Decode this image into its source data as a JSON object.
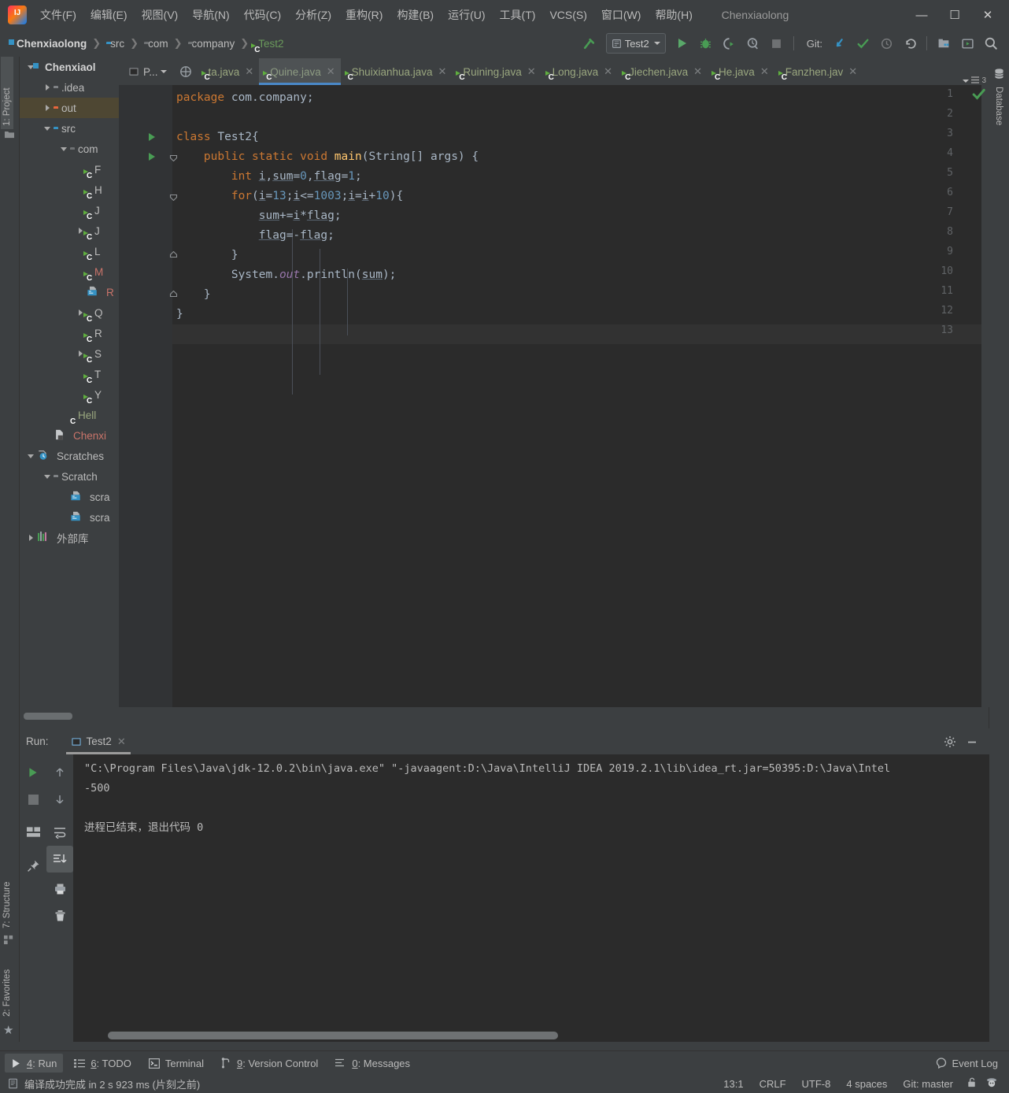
{
  "window": {
    "title": "Chenxiaolong",
    "minimize": "—",
    "maximize": "☐",
    "close": "✕"
  },
  "menu": {
    "items": [
      {
        "label": "文件(F)",
        "name": "menu-file"
      },
      {
        "label": "编辑(E)",
        "name": "menu-edit"
      },
      {
        "label": "视图(V)",
        "name": "menu-view"
      },
      {
        "label": "导航(N)",
        "name": "menu-navigate"
      },
      {
        "label": "代码(C)",
        "name": "menu-code"
      },
      {
        "label": "分析(Z)",
        "name": "menu-analyze"
      },
      {
        "label": "重构(R)",
        "name": "menu-refactor"
      },
      {
        "label": "构建(B)",
        "name": "menu-build"
      },
      {
        "label": "运行(U)",
        "name": "menu-run"
      },
      {
        "label": "工具(T)",
        "name": "menu-tools"
      },
      {
        "label": "VCS(S)",
        "name": "menu-vcs"
      },
      {
        "label": "窗口(W)",
        "name": "menu-window"
      },
      {
        "label": "帮助(H)",
        "name": "menu-help"
      }
    ]
  },
  "navbar": {
    "breadcrumbs": [
      {
        "label": "Chenxiaolong",
        "icon": "module-icon",
        "style": "bold"
      },
      {
        "label": "src",
        "icon": "folder-blue-icon",
        "style": "normal"
      },
      {
        "label": "com",
        "icon": "folder-dark-icon",
        "style": "normal"
      },
      {
        "label": "company",
        "icon": "folder-dark-icon",
        "style": "normal"
      },
      {
        "label": "Test2",
        "icon": "java-class-icon",
        "style": "green"
      }
    ],
    "separator": "❯",
    "run_config": "Test2",
    "git_label": "Git:",
    "toolbar_icons": [
      "build-hammer-icon",
      "run-icon",
      "debug-icon",
      "run-coverage-icon",
      "profiler-icon",
      "stop-icon",
      "vcs-update-icon",
      "vcs-commit-icon",
      "vcs-history-icon",
      "vcs-rollback-icon",
      "project-structure-icon",
      "select-in-icon",
      "search-everywhere-icon"
    ]
  },
  "left_strip": {
    "top": [
      {
        "label": "1: Project",
        "name": "tool-button-project",
        "selected": true
      }
    ],
    "bottom": [
      {
        "label": "7: Structure",
        "name": "tool-button-structure",
        "selected": false
      },
      {
        "label": "2: Favorites",
        "name": "tool-button-favorites",
        "selected": false
      }
    ]
  },
  "right_strip": {
    "items": [
      {
        "label": "Database",
        "name": "tool-button-database"
      }
    ]
  },
  "project_tree": {
    "header": "Project",
    "nodes": [
      {
        "label": "Chenxiaol",
        "indent": 0,
        "arrow": "down",
        "icon": "module-icon",
        "style": "bold",
        "selected": false
      },
      {
        "label": ".idea",
        "indent": 1,
        "arrow": "right",
        "icon": "folder-gray-icon",
        "style": "normal",
        "selected": false
      },
      {
        "label": "out",
        "indent": 1,
        "arrow": "right",
        "icon": "folder-orange-icon",
        "style": "normal",
        "selected": true
      },
      {
        "label": "src",
        "indent": 1,
        "arrow": "down",
        "icon": "folder-blue-icon",
        "style": "normal",
        "selected": false
      },
      {
        "label": "com",
        "indent": 2,
        "arrow": "down",
        "icon": "folder-dark-icon",
        "style": "normal",
        "selected": false
      },
      {
        "label": "F",
        "indent": 3,
        "arrow": "none",
        "icon": "java-class-icon",
        "style": "normal",
        "selected": false
      },
      {
        "label": "H",
        "indent": 3,
        "arrow": "none",
        "icon": "java-class-icon",
        "style": "normal",
        "selected": false
      },
      {
        "label": "J",
        "indent": 3,
        "arrow": "none",
        "icon": "java-class-icon",
        "style": "normal",
        "selected": false
      },
      {
        "label": "J",
        "indent": 3,
        "arrow": "right",
        "icon": "java-class-icon",
        "style": "normal",
        "selected": false
      },
      {
        "label": "L",
        "indent": 3,
        "arrow": "none",
        "icon": "java-class-icon",
        "style": "normal",
        "selected": false
      },
      {
        "label": "M",
        "indent": 3,
        "arrow": "none",
        "icon": "java-class-icon",
        "style": "red",
        "selected": false
      },
      {
        "label": "R",
        "indent": 3,
        "arrow": "none",
        "icon": "scratch-file-icon",
        "style": "red",
        "selected": false
      },
      {
        "label": "Q",
        "indent": 3,
        "arrow": "right",
        "icon": "java-class-icon",
        "style": "normal",
        "selected": false
      },
      {
        "label": "R",
        "indent": 3,
        "arrow": "none",
        "icon": "java-class-icon",
        "style": "normal",
        "selected": false
      },
      {
        "label": "S",
        "indent": 3,
        "arrow": "right",
        "icon": "java-class-icon",
        "style": "normal",
        "selected": false
      },
      {
        "label": "T",
        "indent": 3,
        "arrow": "none",
        "icon": "java-class-icon",
        "style": "normal",
        "selected": false
      },
      {
        "label": "Y",
        "indent": 3,
        "arrow": "none",
        "icon": "java-class-icon",
        "style": "normal",
        "selected": false
      },
      {
        "label": "Hell",
        "indent": 2,
        "arrow": "none",
        "icon": "java-class-plain-icon",
        "style": "grn",
        "selected": false
      },
      {
        "label": "Chenxi",
        "indent": 1,
        "arrow": "none",
        "icon": "iml-file-icon",
        "style": "red",
        "selected": false
      },
      {
        "label": "Scratches",
        "indent": 0,
        "arrow": "down",
        "icon": "scratches-icon",
        "style": "normal",
        "selected": false
      },
      {
        "label": "Scratch",
        "indent": 1,
        "arrow": "down",
        "icon": "folder-gray-icon",
        "style": "normal",
        "selected": false
      },
      {
        "label": "scra",
        "indent": 2,
        "arrow": "none",
        "icon": "scratch-file-icon",
        "style": "normal",
        "selected": false
      },
      {
        "label": "scra",
        "indent": 2,
        "arrow": "none",
        "icon": "scratch-file-icon",
        "style": "normal",
        "selected": false
      },
      {
        "label": "外部库",
        "indent": 0,
        "arrow": "right",
        "icon": "external-libraries-icon",
        "style": "normal",
        "selected": false
      }
    ]
  },
  "editor_tabs": {
    "project_button": "P...",
    "tabs": [
      {
        "label": "ta.java",
        "active": false,
        "name": "editor-tab-ta"
      },
      {
        "label": "Quine.java",
        "active": true,
        "name": "editor-tab-quine"
      },
      {
        "label": "Shuixianhua.java",
        "active": false,
        "name": "editor-tab-shuixianhua"
      },
      {
        "label": "Ruining.java",
        "active": false,
        "name": "editor-tab-ruining"
      },
      {
        "label": "Long.java",
        "active": false,
        "name": "editor-tab-long"
      },
      {
        "label": "Jiechen.java",
        "active": false,
        "name": "editor-tab-jiechen"
      },
      {
        "label": "He.java",
        "active": false,
        "name": "editor-tab-he"
      },
      {
        "label": "Fanzhen.jav",
        "active": false,
        "name": "editor-tab-fanzhen"
      }
    ],
    "close_glyph": "✕",
    "overflow_count": "3"
  },
  "editor": {
    "current_line": 13,
    "lines": [
      {
        "n": 1,
        "gutter_run": false,
        "fold": "none",
        "tokens": [
          {
            "t": "package ",
            "c": "kw"
          },
          {
            "t": "com.company;",
            "c": ""
          }
        ]
      },
      {
        "n": 2,
        "gutter_run": false,
        "fold": "none",
        "tokens": []
      },
      {
        "n": 3,
        "gutter_run": true,
        "fold": "none",
        "tokens": [
          {
            "t": "class ",
            "c": "kw"
          },
          {
            "t": "Test2{",
            "c": ""
          }
        ]
      },
      {
        "n": 4,
        "gutter_run": true,
        "fold": "open",
        "tokens": [
          {
            "t": "    ",
            "c": ""
          },
          {
            "t": "public static void ",
            "c": "kw"
          },
          {
            "t": "main",
            "c": "meth"
          },
          {
            "t": "(String[] args) {",
            "c": ""
          }
        ]
      },
      {
        "n": 5,
        "gutter_run": false,
        "fold": "none",
        "tokens": [
          {
            "t": "        ",
            "c": ""
          },
          {
            "t": "int ",
            "c": "kw"
          },
          {
            "t": "i",
            "c": "und"
          },
          {
            "t": ",",
            "c": ""
          },
          {
            "t": "sum",
            "c": "und"
          },
          {
            "t": "=",
            "c": ""
          },
          {
            "t": "0",
            "c": "num"
          },
          {
            "t": ",",
            "c": ""
          },
          {
            "t": "flag",
            "c": "und"
          },
          {
            "t": "=",
            "c": ""
          },
          {
            "t": "1",
            "c": "num"
          },
          {
            "t": ";",
            "c": ""
          }
        ]
      },
      {
        "n": 6,
        "gutter_run": false,
        "fold": "open",
        "tokens": [
          {
            "t": "        ",
            "c": ""
          },
          {
            "t": "for",
            "c": "kw"
          },
          {
            "t": "(",
            "c": ""
          },
          {
            "t": "i",
            "c": "und"
          },
          {
            "t": "=",
            "c": ""
          },
          {
            "t": "13",
            "c": "num"
          },
          {
            "t": ";",
            "c": ""
          },
          {
            "t": "i",
            "c": "und"
          },
          {
            "t": "<=",
            "c": ""
          },
          {
            "t": "1003",
            "c": "num"
          },
          {
            "t": ";",
            "c": ""
          },
          {
            "t": "i",
            "c": "und"
          },
          {
            "t": "=",
            "c": ""
          },
          {
            "t": "i",
            "c": "und"
          },
          {
            "t": "+",
            "c": ""
          },
          {
            "t": "10",
            "c": "num"
          },
          {
            "t": "){",
            "c": ""
          }
        ]
      },
      {
        "n": 7,
        "gutter_run": false,
        "fold": "none",
        "tokens": [
          {
            "t": "            ",
            "c": ""
          },
          {
            "t": "sum",
            "c": "und"
          },
          {
            "t": "+=",
            "c": ""
          },
          {
            "t": "i",
            "c": "und"
          },
          {
            "t": "*",
            "c": ""
          },
          {
            "t": "flag",
            "c": "und"
          },
          {
            "t": ";",
            "c": ""
          }
        ]
      },
      {
        "n": 8,
        "gutter_run": false,
        "fold": "none",
        "tokens": [
          {
            "t": "            ",
            "c": ""
          },
          {
            "t": "flag",
            "c": "und"
          },
          {
            "t": "=-",
            "c": ""
          },
          {
            "t": "flag",
            "c": "und"
          },
          {
            "t": ";",
            "c": ""
          }
        ]
      },
      {
        "n": 9,
        "gutter_run": false,
        "fold": "close",
        "tokens": [
          {
            "t": "        }",
            "c": ""
          }
        ]
      },
      {
        "n": 10,
        "gutter_run": false,
        "fold": "none",
        "tokens": [
          {
            "t": "        System.",
            "c": ""
          },
          {
            "t": "out",
            "c": "fld"
          },
          {
            "t": ".println(",
            "c": ""
          },
          {
            "t": "sum",
            "c": "und"
          },
          {
            "t": ");",
            "c": ""
          }
        ]
      },
      {
        "n": 11,
        "gutter_run": false,
        "fold": "close",
        "tokens": [
          {
            "t": "    }",
            "c": ""
          }
        ]
      },
      {
        "n": 12,
        "gutter_run": false,
        "fold": "none",
        "tokens": [
          {
            "t": "}",
            "c": ""
          }
        ]
      },
      {
        "n": 13,
        "gutter_run": false,
        "fold": "none",
        "tokens": []
      }
    ]
  },
  "run_window": {
    "label": "Run:",
    "tab": "Test2",
    "close_glyph": "✕",
    "toolbar_left": [
      "rerun-icon",
      "stop-icon",
      "layout-icon",
      "pin-icon"
    ],
    "toolbar_right": [
      "up-arrow-icon",
      "down-arrow-icon",
      "soft-wrap-icon",
      "scroll-to-end-icon",
      "print-icon",
      "trash-icon"
    ],
    "console": [
      "\"C:\\Program Files\\Java\\jdk-12.0.2\\bin\\java.exe\" \"-javaagent:D:\\Java\\IntelliJ IDEA 2019.2.1\\lib\\idea_rt.jar=50395:D:\\Java\\Intel",
      "-500",
      "",
      "进程已结束，退出代码 0"
    ],
    "settings_icon": "gear-icon",
    "hide_icon": "minimize-icon"
  },
  "bottom_bar": {
    "buttons": [
      {
        "key": "4",
        "label": ": Run",
        "name": "bottom-tab-run",
        "selected": true,
        "icon": "run-icon"
      },
      {
        "key": "6",
        "label": ": TODO",
        "name": "bottom-tab-todo",
        "selected": false,
        "icon": "todo-icon"
      },
      {
        "key": "",
        "label": "Terminal",
        "name": "bottom-tab-terminal",
        "selected": false,
        "icon": "terminal-icon"
      },
      {
        "key": "9",
        "label": ": Version Control",
        "name": "bottom-tab-version-control",
        "selected": false,
        "icon": "vcs-icon"
      },
      {
        "key": "0",
        "label": ": Messages",
        "name": "bottom-tab-messages",
        "selected": false,
        "icon": "messages-icon"
      }
    ],
    "event_log": "Event Log"
  },
  "status_bar": {
    "message": "编译成功完成 in 2 s 923 ms (片刻之前)",
    "caret": "13:1",
    "line_separator": "CRLF",
    "encoding": "UTF-8",
    "indent": "4 spaces",
    "branch": "Git: master",
    "lock_icon": "unlocked-icon",
    "inspector_icon": "hector-icon"
  }
}
